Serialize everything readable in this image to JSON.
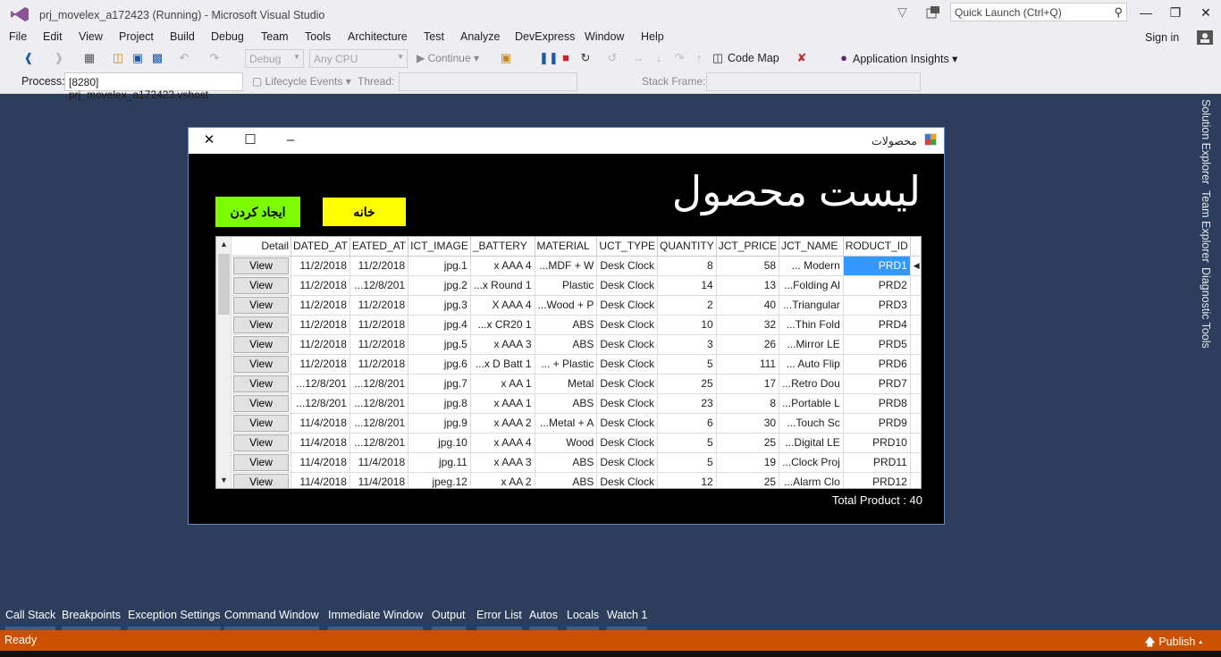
{
  "vs": {
    "title": "prj_movelex_a172423 (Running) - Microsoft Visual Studio",
    "quick_launch_placeholder": "Quick Launch (Ctrl+Q)",
    "menu": [
      "File",
      "Edit",
      "View",
      "Project",
      "Build",
      "Debug",
      "Team",
      "Tools",
      "Architecture",
      "Test",
      "Analyze",
      "DevExpress",
      "Window",
      "Help"
    ],
    "sign_in": "Sign in",
    "toolbar": {
      "config": "Debug",
      "platform": "Any CPU",
      "continue": "Continue",
      "code_map": "Code Map",
      "app_insights": "Application Insights"
    },
    "process_bar": {
      "process_label": "Process:",
      "process_value": "[8280] prj_movelex_a172423.vshost",
      "lifecycle": "Lifecycle Events",
      "thread_label": "Thread:",
      "stack_frame_label": "Stack Frame:"
    },
    "side_tabs": [
      "Solution Explorer",
      "Team Explorer",
      "Diagnostic Tools"
    ],
    "bottom_tabs": [
      "Call Stack",
      "Breakpoints",
      "Exception Settings",
      "Command Window",
      "Immediate Window",
      "Output",
      "Error List",
      "Autos",
      "Locals",
      "Watch 1"
    ],
    "status": "Ready",
    "publish": "Publish"
  },
  "form": {
    "title": "محصولات",
    "heading": "لیست محصول",
    "create_button": "ایجاد کردن",
    "home_button": "خانه",
    "total": "Total Product : 40",
    "columns": [
      "Detail",
      "DATED_AT",
      "EATED_AT",
      "ICT_IMAGE",
      "_BATTERY",
      "MATERIAL",
      "UCT_TYPE",
      "QUANTITY",
      "JCT_PRICE",
      "JCT_NAME",
      "RODUCT_ID"
    ],
    "view_label": "View",
    "rows": [
      {
        "d1": "11/2/2018",
        "d2": "11/2/2018",
        "img": "jpg.1",
        "bat": "x AAA 4",
        "mat": "...MDF + W",
        "type": "Desk Clock",
        "qty": "8",
        "price": "58",
        "name": "... Modern",
        "id": "PRD1"
      },
      {
        "d1": "11/2/2018",
        "d2": "...12/8/201",
        "img": "jpg.2",
        "bat": "...x Round 1",
        "mat": "Plastic",
        "type": "Desk Clock",
        "qty": "14",
        "price": "13",
        "name": "...Folding Al",
        "id": "PRD2"
      },
      {
        "d1": "11/2/2018",
        "d2": "11/2/2018",
        "img": "jpg.3",
        "bat": "X AAA 4",
        "mat": "...Wood + P",
        "type": "Desk Clock",
        "qty": "2",
        "price": "40",
        "name": "...Triangular",
        "id": "PRD3"
      },
      {
        "d1": "11/2/2018",
        "d2": "11/2/2018",
        "img": "jpg.4",
        "bat": "...x CR20 1",
        "mat": "ABS",
        "type": "Desk Clock",
        "qty": "10",
        "price": "32",
        "name": "...Thin Fold",
        "id": "PRD4"
      },
      {
        "d1": "11/2/2018",
        "d2": "11/2/2018",
        "img": "jpg.5",
        "bat": "x AAA 3",
        "mat": "ABS",
        "type": "Desk Clock",
        "qty": "3",
        "price": "26",
        "name": "...Mirror LE",
        "id": "PRD5"
      },
      {
        "d1": "11/2/2018",
        "d2": "11/2/2018",
        "img": "jpg.6",
        "bat": "...x D Batt 1",
        "mat": "... + Plastic",
        "type": "Desk Clock",
        "qty": "5",
        "price": "111",
        "name": "... Auto Flip",
        "id": "PRD6"
      },
      {
        "d1": "...12/8/201",
        "d2": "...12/8/201",
        "img": "jpg.7",
        "bat": "x AA 1",
        "mat": "Metal",
        "type": "Desk Clock",
        "qty": "25",
        "price": "17",
        "name": "...Retro Dou",
        "id": "PRD7"
      },
      {
        "d1": "...12/8/201",
        "d2": "...12/8/201",
        "img": "jpg.8",
        "bat": "x AAA 1",
        "mat": "ABS",
        "type": "Desk Clock",
        "qty": "23",
        "price": "8",
        "name": "...Portable L",
        "id": "PRD8"
      },
      {
        "d1": "11/4/2018",
        "d2": "...12/8/201",
        "img": "jpg.9",
        "bat": "x AAA 2",
        "mat": "...Metal + A",
        "type": "Desk Clock",
        "qty": "6",
        "price": "30",
        "name": "...Touch Sc",
        "id": "PRD9"
      },
      {
        "d1": "11/4/2018",
        "d2": "...12/8/201",
        "img": "jpg.10",
        "bat": "x AAA 4",
        "mat": "Wood",
        "type": "Desk Clock",
        "qty": "5",
        "price": "25",
        "name": "...Digital LE",
        "id": "PRD10"
      },
      {
        "d1": "11/4/2018",
        "d2": "11/4/2018",
        "img": "jpg.11",
        "bat": "x AAA 3",
        "mat": "ABS",
        "type": "Desk Clock",
        "qty": "5",
        "price": "19",
        "name": "...Clock Proj",
        "id": "PRD11"
      },
      {
        "d1": "11/4/2018",
        "d2": "11/4/2018",
        "img": "jpeg.12",
        "bat": "x AA 2",
        "mat": "ABS",
        "type": "Desk Clock",
        "qty": "12",
        "price": "25",
        "name": "...Alarm Clo",
        "id": "PRD12"
      }
    ]
  },
  "colors": {
    "vs_chrome": "#eeeef2",
    "vs_background": "#2d3e5c",
    "status_bar": "#ca5100",
    "create_button": "#7cfc00",
    "home_button": "#ffff00",
    "selection": "#3399ff"
  },
  "icons": [
    "vs-logo-icon",
    "filter-icon",
    "feedback-icon",
    "search-icon",
    "minimize-icon",
    "restore-icon",
    "close-icon",
    "account-icon",
    "back-icon",
    "forward-icon",
    "save-icon",
    "pause-icon",
    "stop-icon",
    "restart-icon",
    "code-map-icon",
    "lightbulb-icon",
    "publish-up-arrow-icon",
    "form-app-icon"
  ]
}
